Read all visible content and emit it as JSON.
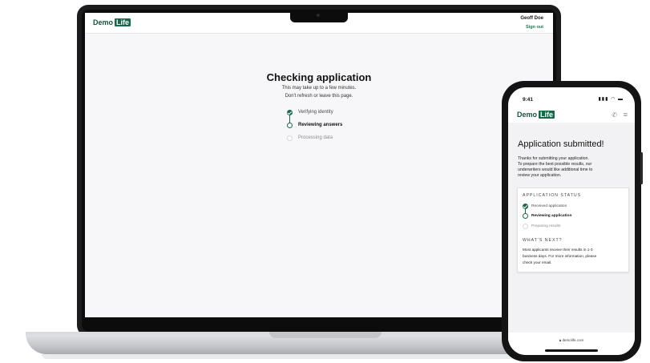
{
  "desktop": {
    "logo": {
      "word": "Demo",
      "box": "Life"
    },
    "user_name": "Geoff Doe",
    "sign_out": "Sign out",
    "title": "Checking application",
    "subtitle_line1": "This may take up to a few minutes.",
    "subtitle_line2": "Don't refresh or leave this page.",
    "steps": [
      {
        "label": "Verifying identity",
        "state": "done"
      },
      {
        "label": "Reviewing answers",
        "state": "active"
      },
      {
        "label": "Processing data",
        "state": "pending"
      }
    ]
  },
  "mobile": {
    "status_time": "9:41",
    "status_icons": "signal-icon wifi-icon battery-icon",
    "logo": {
      "word": "Demo",
      "box": "Life"
    },
    "title": "Application submitted!",
    "intro": [
      "Thanks for submitting your application.",
      "To prepare the best possible results, our",
      "underwriters would like additional time to",
      "review your application."
    ],
    "status_heading": "APPLICATION STATUS",
    "steps": [
      {
        "label": "Received application",
        "state": "done"
      },
      {
        "label": "Reviewing application",
        "state": "active"
      },
      {
        "label": "Preparing results",
        "state": "pending"
      }
    ],
    "next_heading": "WHAT'S NEXT?",
    "next_text": [
      "Most applicants receive their results in 1-3",
      "business days. For more information, please",
      "check your email."
    ],
    "url": "demolife.com"
  },
  "colors": {
    "brand": "#19684a",
    "page_bg": "#f7f7f9"
  }
}
